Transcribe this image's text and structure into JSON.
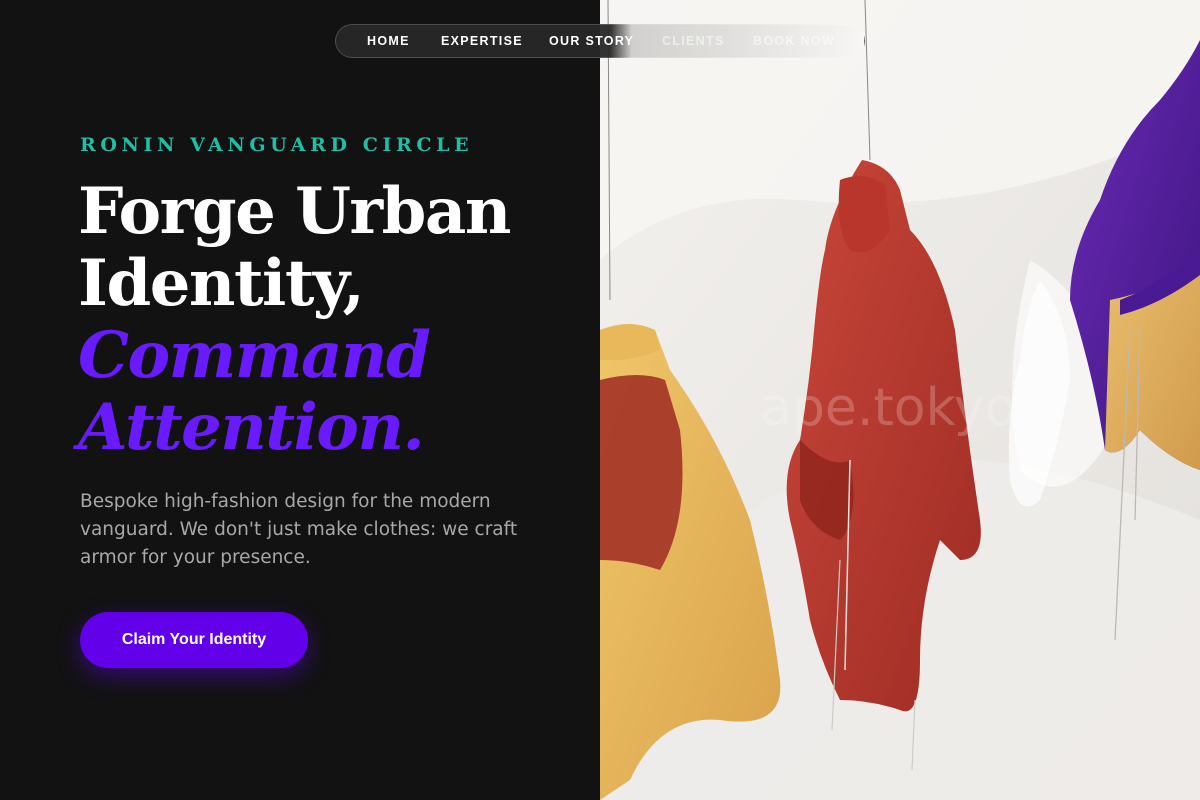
{
  "nav": {
    "items": [
      {
        "label": "HOME"
      },
      {
        "label": "EXPERTISE"
      },
      {
        "label": "OUR STORY"
      },
      {
        "label": "CLIENTS"
      },
      {
        "label": "BOOK NOW"
      }
    ]
  },
  "hero": {
    "eyebrow": "RONIN VANGUARD CIRCLE",
    "headline_line1": "Forge Urban",
    "headline_line2": "Identity,",
    "headline_accent_line1": "Command",
    "headline_accent_line2": "Attention.",
    "description": "Bespoke high-fashion design for the modern vanguard. We don't just make clothes: we craft armor for your presence.",
    "cta_label": "Claim Your Identity"
  },
  "image": {
    "watermark": "ape.tokyo"
  },
  "colors": {
    "background": "#121212",
    "eyebrow": "#1fbfa6",
    "accent": "#6a1aff",
    "cta": "#6200ea",
    "description": "#a8a8a8"
  }
}
